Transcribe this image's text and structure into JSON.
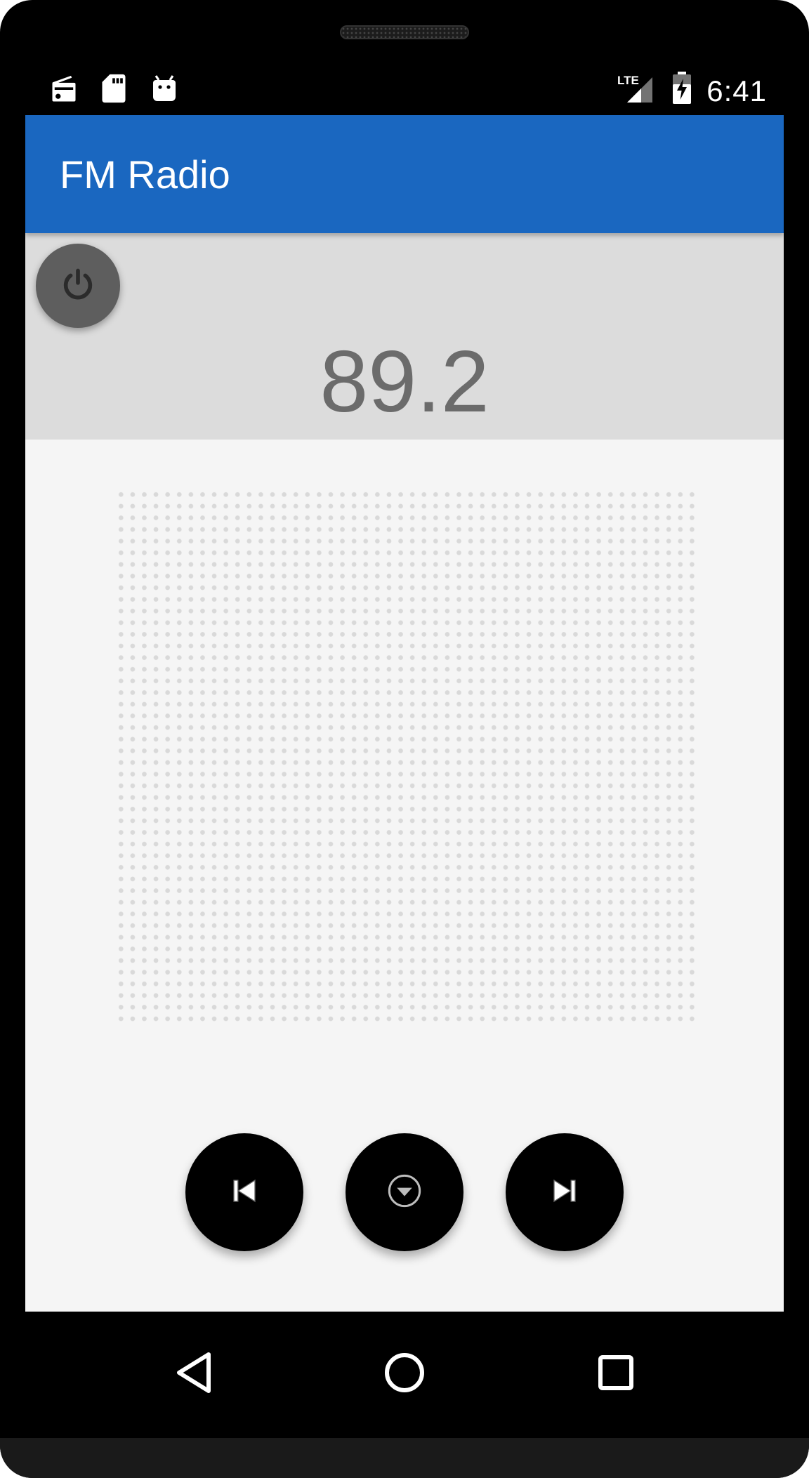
{
  "status_bar": {
    "time": "6:41",
    "network": "LTE",
    "left_icons": [
      "radio-icon",
      "sd-card-icon",
      "android-icon"
    ],
    "right_icons": [
      "lte-signal-icon",
      "battery-charging-icon"
    ]
  },
  "app_bar": {
    "title": "FM Radio",
    "color": "#1a67c0"
  },
  "tuner": {
    "frequency": "89.2",
    "power_icon": "power-icon"
  },
  "controls": [
    {
      "name": "previous-station-button",
      "icon": "skip-previous-icon"
    },
    {
      "name": "station-list-button",
      "icon": "dropdown-circle-icon"
    },
    {
      "name": "next-station-button",
      "icon": "skip-next-icon"
    }
  ],
  "nav_bar": {
    "back_icon": "back-icon",
    "home_icon": "home-icon",
    "recents_icon": "recents-icon"
  }
}
